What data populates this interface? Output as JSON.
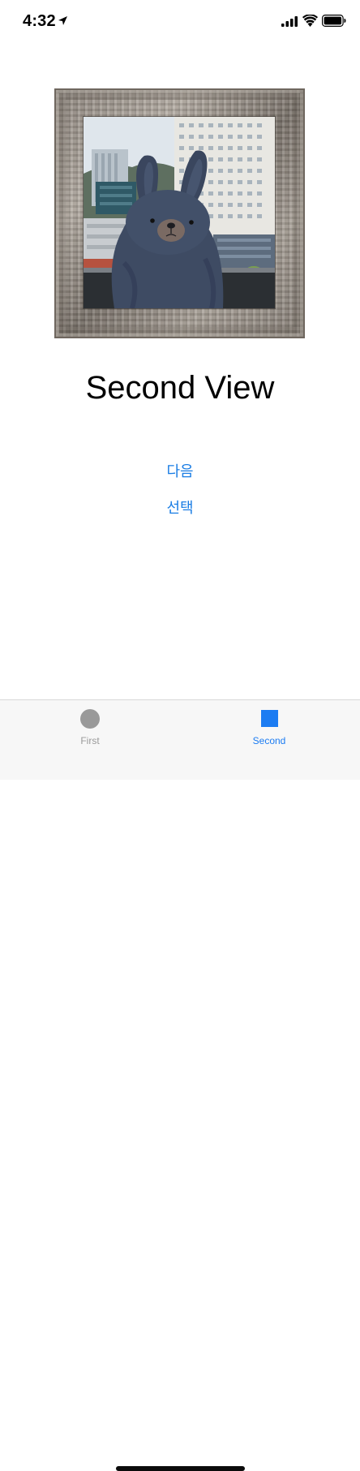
{
  "status_bar": {
    "time": "4:32",
    "icons": [
      "location-arrow-icon",
      "cellular-signal-icon",
      "wifi-icon",
      "battery-icon"
    ]
  },
  "photo": {
    "subject": "plush bunny toy in picture frame"
  },
  "main": {
    "title": "Second View",
    "next_label": "다음",
    "select_label": "선택"
  },
  "tab_bar": {
    "tabs": [
      {
        "label": "First",
        "icon": "circle-icon",
        "selected": false
      },
      {
        "label": "Second",
        "icon": "square-icon",
        "selected": true
      }
    ]
  },
  "colors": {
    "accent": "#1c7cf2",
    "link": "#1a7de4",
    "inactive": "#999999",
    "tab_bar_bg": "#f7f7f7"
  }
}
